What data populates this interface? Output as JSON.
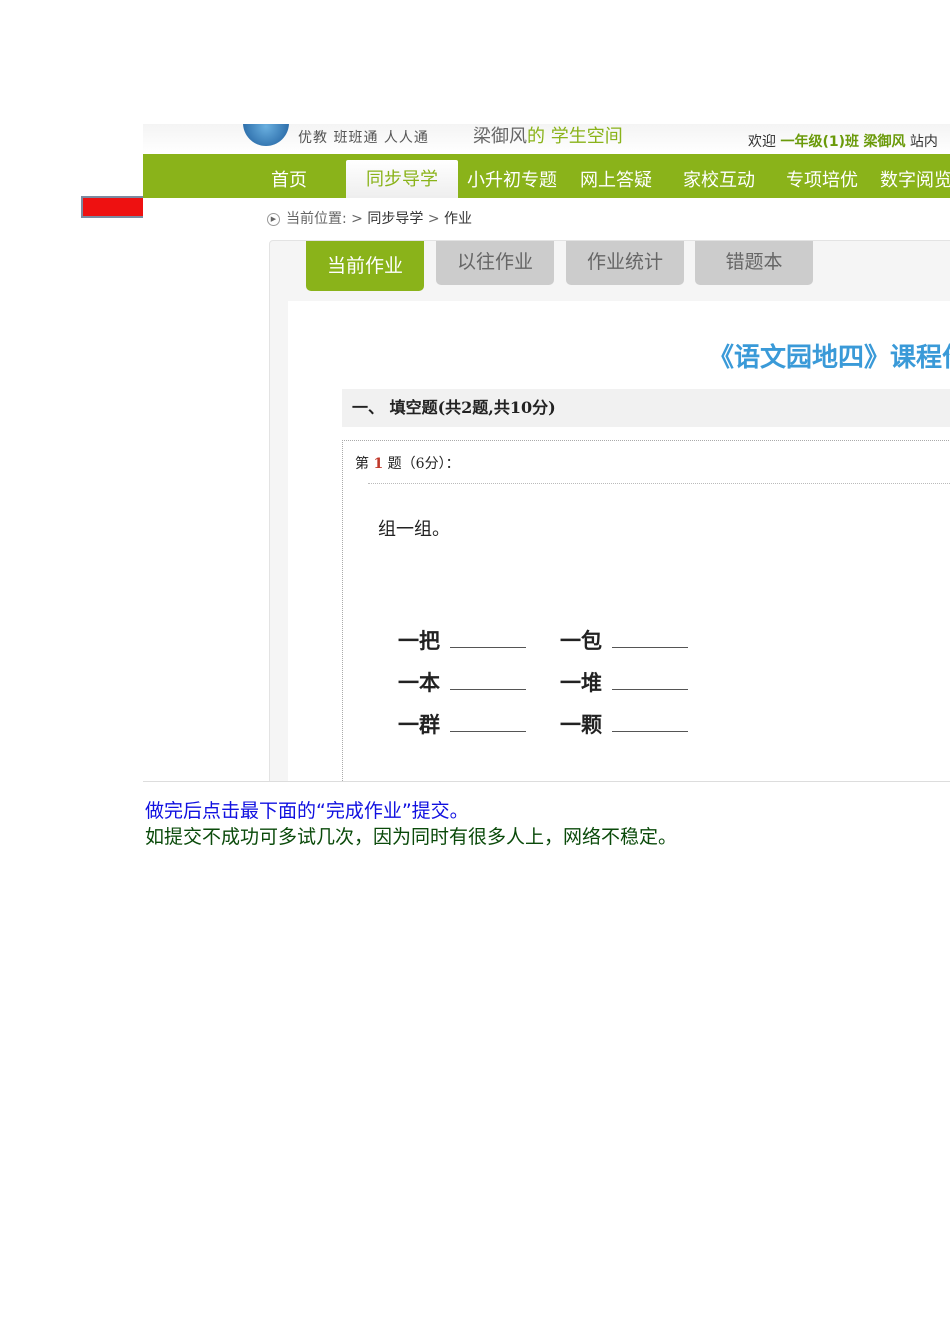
{
  "header": {
    "brand": "优教 班班通 人人通",
    "space_name": "梁御风",
    "space_suffix": "的 学生空间",
    "welcome": "欢迎",
    "class": "一年级(1)班",
    "user": "梁御风",
    "site": "站内"
  },
  "nav": [
    "首页",
    "同步导学",
    "小升初专题",
    "网上答疑",
    "家校互动",
    "专项培优",
    "数字阅览"
  ],
  "breadcrumb": {
    "label": "当前位置:",
    "sep": ">",
    "items": [
      "同步导学",
      "作业"
    ]
  },
  "tabs": [
    "当前作业",
    "以往作业",
    "作业统计",
    "错题本"
  ],
  "homework": {
    "title": "《语文园地四》课程作业",
    "section": "一、 填空题(共2题,共10分)",
    "q_prefix": "第",
    "q_num": "1",
    "q_suffix": "题（6分）：",
    "prompt": "组一组。",
    "items": [
      "一把",
      "一包",
      "一本",
      "一堆",
      "一群",
      "一颗"
    ]
  },
  "notes": [
    "做完后点击最下面的“完成作业”提交。",
    "如提交不成功可多试几次，因为同时有很多人上，网络不稳定。"
  ],
  "colors": {
    "green": "#8ab31a",
    "arrow": "#ee1111",
    "title": "#3a9ad8"
  }
}
